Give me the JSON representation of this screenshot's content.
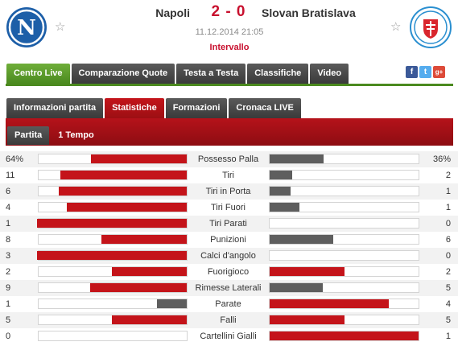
{
  "match": {
    "home_team": "Napoli",
    "away_team": "Slovan Bratislava",
    "score": "2 - 0",
    "datetime": "11.12.2014 21:05",
    "status": "Intervallo"
  },
  "main_tabs": [
    "Centro Live",
    "Comparazione Quote",
    "Testa a Testa",
    "Classifiche",
    "Video"
  ],
  "sub_tabs": [
    "Informazioni partita",
    "Statistiche",
    "Formazioni",
    "Cronaca LIVE"
  ],
  "period_tabs": [
    "Partita",
    "1 Tempo"
  ],
  "social": {
    "facebook": "f",
    "twitter": "t",
    "google_plus": "g+"
  },
  "stats": [
    {
      "label": "Possesso Palla",
      "home": "64%",
      "away": "36%"
    },
    {
      "label": "Tiri",
      "home": "11",
      "away": "2"
    },
    {
      "label": "Tiri in Porta",
      "home": "6",
      "away": "1"
    },
    {
      "label": "Tiri Fuori",
      "home": "4",
      "away": "1"
    },
    {
      "label": "Tiri Parati",
      "home": "1",
      "away": "0"
    },
    {
      "label": "Punizioni",
      "home": "8",
      "away": "6"
    },
    {
      "label": "Calci d'angolo",
      "home": "3",
      "away": "0"
    },
    {
      "label": "Fuorigioco",
      "home": "2",
      "away": "2"
    },
    {
      "label": "Rimesse Laterali",
      "home": "9",
      "away": "5"
    },
    {
      "label": "Parate",
      "home": "1",
      "away": "4"
    },
    {
      "label": "Falli",
      "home": "5",
      "away": "5"
    },
    {
      "label": "Cartellini Gialli",
      "home": "0",
      "away": "1"
    }
  ],
  "colors": {
    "accent_red": "#c4141a",
    "accent_green": "#4b8a1f",
    "dark_tab": "#3a3a3a",
    "bar_loser": "#5e5e5e"
  }
}
